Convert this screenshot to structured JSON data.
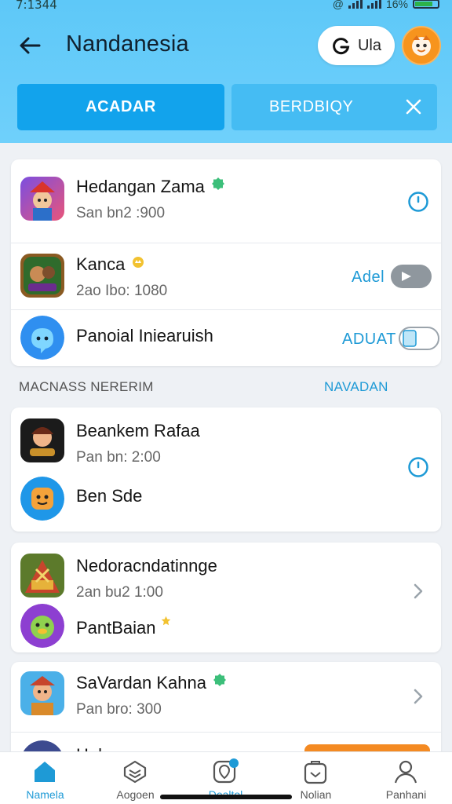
{
  "status": {
    "time": "7:1344",
    "battery": "16%"
  },
  "header": {
    "title": "Nandanesia",
    "pill_label": "Ula"
  },
  "tabs": {
    "active": "ACADAR",
    "secondary": "BERDBIQY"
  },
  "list1": [
    {
      "name": "Hedangan Zama",
      "sub": "San bn2 :900",
      "action": "clock",
      "badge_color": "#3cbf7a"
    },
    {
      "name": "Kanca",
      "sub": "2ao Ibo: 1080",
      "action_label": "Adel",
      "toggle": "off",
      "badge_color": "#f2c230"
    },
    {
      "name": "Panoial Iniearuish",
      "action_label": "ADUAT",
      "toggle": "on"
    }
  ],
  "section": {
    "title": "MACNASS NERERIM",
    "link": "NAVADAN"
  },
  "list2": [
    {
      "name": "Beankem Rafaa",
      "sub": "Pan bn: 2:00",
      "action": "clock"
    },
    {
      "name": "Ben Sde"
    }
  ],
  "list3": [
    {
      "name": "Nedoracndatinnge",
      "sub": "2an bu2 1:00"
    },
    {
      "name": "PantBaian",
      "badge_color": "#f2c230"
    }
  ],
  "list4": [
    {
      "name": "SaVardan Kahna",
      "sub": "Pan bro: 300",
      "badge_color": "#3cbf7a"
    },
    {
      "name": "Halo"
    }
  ],
  "nav": [
    {
      "label": "Namela",
      "icon": "home-icon",
      "active": true
    },
    {
      "label": "Aogoen",
      "icon": "layers-icon"
    },
    {
      "label": "Dealtol",
      "icon": "location-icon",
      "badge": "1"
    },
    {
      "label": "Nolian",
      "icon": "briefcase-icon"
    },
    {
      "label": "Panhani",
      "icon": "profile-icon"
    }
  ],
  "colors": {
    "header": "#6fd0fb",
    "accent": "#1e9ad6",
    "tab_active": "#12a3ec",
    "avatar": "#f7941d"
  }
}
